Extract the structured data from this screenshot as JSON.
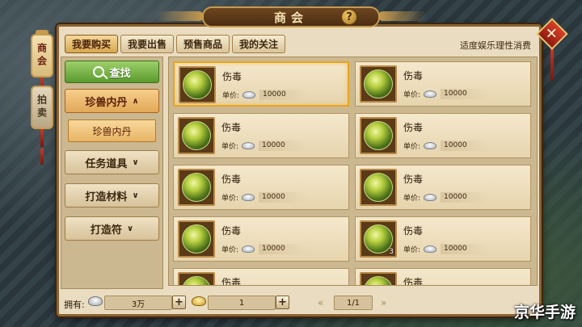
{
  "title": "商会",
  "help_label": "?",
  "close_label": "✕",
  "side_tabs": [
    {
      "label": "商会",
      "active": true
    },
    {
      "label": "拍卖",
      "active": false
    }
  ],
  "tabs": [
    {
      "label": "我要购买",
      "active": true
    },
    {
      "label": "我要出售",
      "active": false
    },
    {
      "label": "预售商品",
      "active": false
    },
    {
      "label": "我的关注",
      "active": false
    }
  ],
  "notice": "适度娱乐理性消费",
  "search_label": "查找",
  "categories": [
    {
      "label": "珍兽内丹",
      "chevron": "∧",
      "open": true
    },
    {
      "label": "任务道具",
      "chevron": "∨",
      "open": false
    },
    {
      "label": "打造材料",
      "chevron": "∨",
      "open": false
    },
    {
      "label": "打造符",
      "chevron": "∨",
      "open": false
    }
  ],
  "sub_category": "珍兽内丹",
  "price_label": "单价:",
  "items": [
    {
      "name": "伤毒",
      "price": "10000",
      "qty": "",
      "selected": true
    },
    {
      "name": "伤毒",
      "price": "10000",
      "qty": "",
      "selected": false
    },
    {
      "name": "伤毒",
      "price": "10000",
      "qty": "",
      "selected": false
    },
    {
      "name": "伤毒",
      "price": "10000",
      "qty": "",
      "selected": false
    },
    {
      "name": "伤毒",
      "price": "10000",
      "qty": "",
      "selected": false
    },
    {
      "name": "伤毒",
      "price": "10000",
      "qty": "",
      "selected": false
    },
    {
      "name": "伤毒",
      "price": "10000",
      "qty": "",
      "selected": false
    },
    {
      "name": "伤毒",
      "price": "10000",
      "qty": "3",
      "selected": false
    },
    {
      "name": "伤毒",
      "price": "",
      "qty": "",
      "selected": false
    },
    {
      "name": "伤毒",
      "price": "",
      "qty": "",
      "selected": false
    }
  ],
  "footer": {
    "own_label": "拥有:",
    "silver_amount": "3万",
    "gold_amount": "1",
    "plus": "+",
    "page": "1/1",
    "prev": "«",
    "next": "»"
  },
  "watermark": "京华手游",
  "colors": {
    "accent_gold": "#c79a4d",
    "search_green": "#5a9a2d",
    "selected_border": "#e8a420",
    "close_red": "#d8402a"
  }
}
